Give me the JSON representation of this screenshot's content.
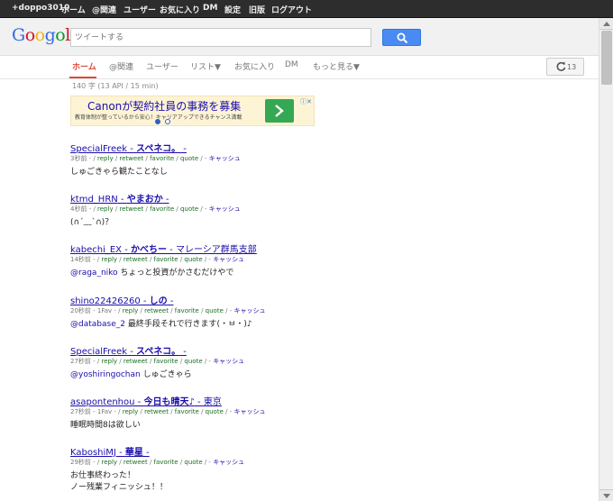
{
  "topbar": {
    "user": "+doppo3010",
    "home": "ホーム",
    "mentions": "@関連",
    "users": "ユーザー",
    "favorites": "お気に入り",
    "dm": "DM",
    "settings": "設定",
    "classic": "旧版",
    "logout": "ログアウト"
  },
  "header": {
    "logo_letters": [
      "G",
      "o",
      "o",
      "g",
      "o",
      "l"
    ],
    "logo_colors": [
      "#3369e8",
      "#d50f25",
      "#eeb211",
      "#3369e8",
      "#009925",
      "#d50f25"
    ],
    "search_placeholder": "ツイートする",
    "search_icon": "search-icon"
  },
  "tabs": {
    "home": "ホーム",
    "mentions": "@関連",
    "users": "ユーザー",
    "lists": "リスト▼",
    "favorites": "お気に入り",
    "dm": "DM",
    "more": "もっと見る▼",
    "refresh_count": "13",
    "refresh_icon": "refresh-icon"
  },
  "status": "140 字 (13 API / 15 min)",
  "ad": {
    "headline": "Canonが契約社員の事務を募集",
    "body": "教育体制が整っているから安心！キャリアアップできるチャンス満載",
    "close": "ⓘ✕",
    "brand_colors": {
      "background": "#fdf4d6",
      "button": "#34a853",
      "link": "#1a0dab"
    }
  },
  "meta_labels": {
    "reply": "reply",
    "retweet": "retweet",
    "favorite": "favorite",
    "quote": "quote",
    "cache": "キャッシュ"
  },
  "tweets": [
    {
      "handle": "SpecialFreek",
      "name": "スペネコ。",
      "location": "",
      "time": "3秒前",
      "fav": "",
      "mention": "",
      "text": "しゅごきゃら観たことなし"
    },
    {
      "handle": "ktmd_HRN",
      "name": "やまおか",
      "location": "",
      "time": "4秒前",
      "fav": "",
      "mention": "",
      "text": "(∩´﹏`∩)？"
    },
    {
      "handle": "kabechi_EX",
      "name": "かべちー",
      "location": "マレーシア群馬支部",
      "time": "14秒前",
      "fav": "",
      "mention": "@raga_niko",
      "text": "ちょっと投資がかさむだけやで"
    },
    {
      "handle": "shino22426260",
      "name": "しの",
      "location": "",
      "time": "20秒前",
      "fav": "1Fav",
      "mention": "@database_2",
      "text": "最終手段それで行きます(・ㅂ・)♪"
    },
    {
      "handle": "SpecialFreek",
      "name": "スペネコ。",
      "location": "",
      "time": "27秒前",
      "fav": "",
      "mention": "@yoshiringochan",
      "text": "しゅごきゃら"
    },
    {
      "handle": "asapontenhou",
      "name": "今日も晴天♪",
      "location": "東京",
      "time": "27秒前",
      "fav": "1Fav",
      "mention": "",
      "text": "睡眠時間8は欲しい"
    },
    {
      "handle": "KaboshiMJ",
      "name": "華星",
      "location": "",
      "time": "29秒前",
      "fav": "",
      "mention": "",
      "text": "お仕事終わった！",
      "text2": "ノー残業フィニッシュ！！"
    }
  ]
}
